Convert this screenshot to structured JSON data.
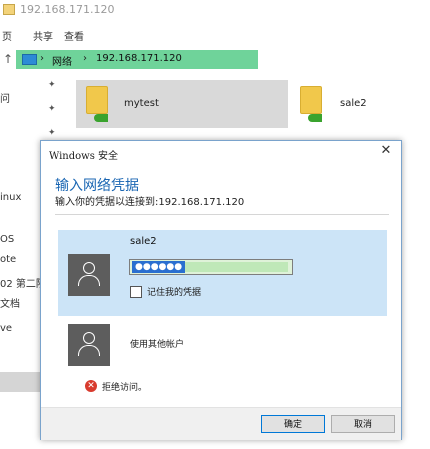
{
  "window": {
    "title": "192.168.171.120"
  },
  "ribbon": {
    "tabs": [
      "页",
      "共享",
      "查看"
    ]
  },
  "address": {
    "crumbs": [
      "网络",
      "192.168.171.120"
    ]
  },
  "left_pane": {
    "items": [
      "问",
      "inux",
      "OS",
      "ote",
      "02 第二阶",
      "文档",
      "ve"
    ]
  },
  "content": {
    "items": [
      {
        "label": "mytest",
        "selected": true
      },
      {
        "label": "sale2",
        "selected": false
      }
    ]
  },
  "dialog": {
    "title": "Windows 安全",
    "heading": "输入网络凭据",
    "subtext": "输入你的凭据以连接到:192.168.171.120",
    "account": {
      "username": "sale2",
      "password_mask": "●●●●●●",
      "remember_label": "记住我的凭据"
    },
    "other_account_label": "使用其他帐户",
    "error_text": "拒绝访问。",
    "buttons": {
      "ok": "确定",
      "cancel": "取消"
    },
    "colors": {
      "heading": "#1a66b3",
      "selected_account_bg": "#cce4f7",
      "error": "#d83b2e",
      "address_bar": "#6fd39a"
    }
  }
}
